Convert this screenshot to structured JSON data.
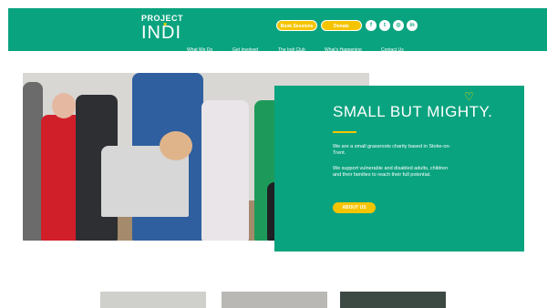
{
  "header": {
    "logo": {
      "line1": "PROJECT",
      "line2": "INDI"
    },
    "buttons": {
      "book": "Book Sessions",
      "donate": "Donate"
    },
    "social": [
      {
        "name": "facebook-icon",
        "glyph": "f"
      },
      {
        "name": "twitter-icon",
        "glyph": "t"
      },
      {
        "name": "instagram-icon",
        "glyph": "◎"
      },
      {
        "name": "linkedin-icon",
        "glyph": "in"
      }
    ],
    "nav": [
      "What We Do",
      "Get Involved",
      "The Indi Club",
      "What's Happening",
      "Contact Us"
    ]
  },
  "hero": {
    "title": "SMALL BUT MIGHTY.",
    "paragraph1": "We are a small grassroots charity based in Stoke-on-Trent.",
    "paragraph2": "We support vulnerable and disabled adults, children and their families to reach their full potential.",
    "button": "ABOUT US"
  },
  "colors": {
    "brand_green": "#0aa37f",
    "accent_yellow": "#f5c400"
  }
}
